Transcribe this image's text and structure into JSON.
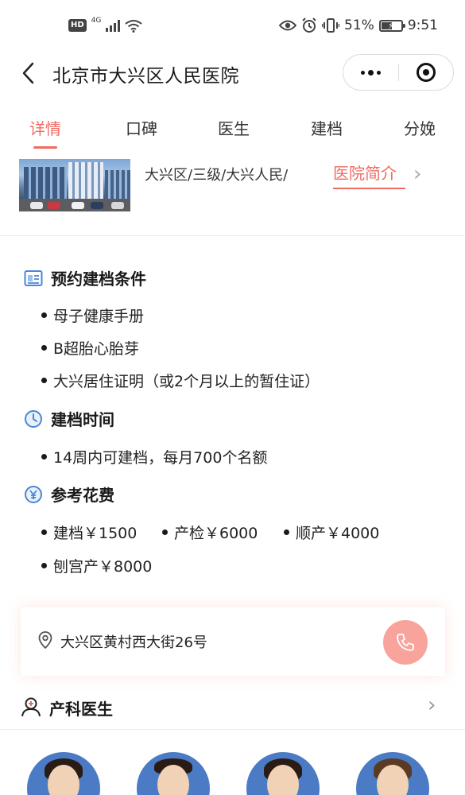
{
  "status_bar": {
    "hd": "HD",
    "network": "4G",
    "battery": "51%",
    "time": "9:51"
  },
  "nav": {
    "back_icon": "chevron-left-icon",
    "title": "北京市大兴区人民医院"
  },
  "tabs": [
    {
      "label": "详情",
      "active": true
    },
    {
      "label": "口碑",
      "active": false
    },
    {
      "label": "医生",
      "active": false
    },
    {
      "label": "建档",
      "active": false
    },
    {
      "label": "分娩",
      "active": false
    }
  ],
  "hospital": {
    "tags": "大兴区/三级/大兴人民/",
    "intro_link": "医院简介"
  },
  "sections": {
    "conditions": {
      "title": "预约建档条件",
      "items": [
        "母子健康手册",
        "B超胎心胎芽",
        "大兴居住证明（或2个月以上的暂住证）"
      ]
    },
    "time": {
      "title": "建档时间",
      "items": [
        "14周内可建档，每月700个名额"
      ]
    },
    "cost": {
      "title": "参考花费",
      "items": [
        "建档￥1500",
        "产检￥6000",
        "顺产￥4000",
        "刨宫产￥8000"
      ]
    }
  },
  "address": {
    "text": "大兴区黄村西大街26号"
  },
  "doctors": {
    "title": "产科医生"
  },
  "colors": {
    "accent": "#ef6b62",
    "phone_button": "#f8a39c",
    "icon_blue": "#4a86d8"
  }
}
